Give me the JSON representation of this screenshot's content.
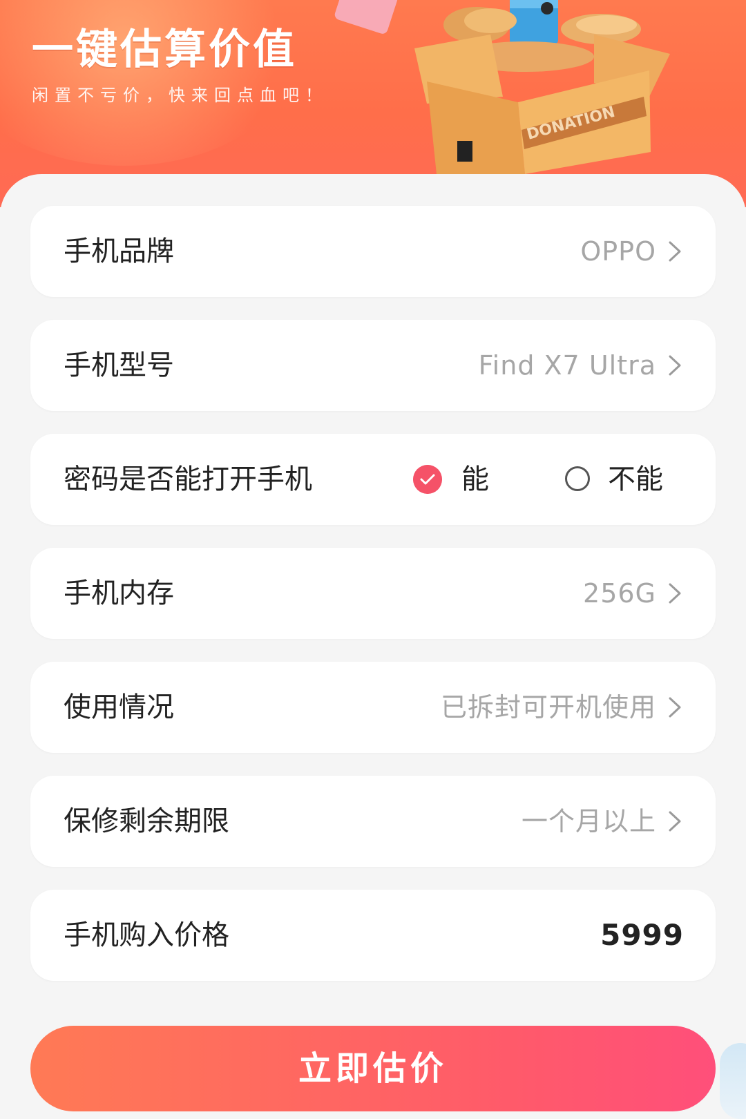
{
  "header": {
    "title": "一键估算价值",
    "subtitle": "闲置不亏价，快来回点血吧！",
    "box_label": "DONATION"
  },
  "form": {
    "brand": {
      "label": "手机品牌",
      "value": "OPPO"
    },
    "model": {
      "label": "手机型号",
      "value": "Find X7 Ultra"
    },
    "unlock": {
      "label": "密码是否能打开手机",
      "options": [
        "能",
        "不能"
      ],
      "selected": "能"
    },
    "storage": {
      "label": "手机内存",
      "value": "256G"
    },
    "condition": {
      "label": "使用情况",
      "value": "已拆封可开机使用"
    },
    "warranty": {
      "label": "保修剩余期限",
      "value": "一个月以上"
    },
    "price": {
      "label": "手机购入价格",
      "value": "5999"
    }
  },
  "submit_label": "立即估价",
  "colors": {
    "accent": "#f55268",
    "header_bg": "#ff7a4f",
    "value_gray": "#a6a6a6"
  },
  "icons": {
    "row_arrow": "chevron-right-icon",
    "radio_selected": "check-circle-icon",
    "radio_unselected": "empty-circle-icon"
  }
}
